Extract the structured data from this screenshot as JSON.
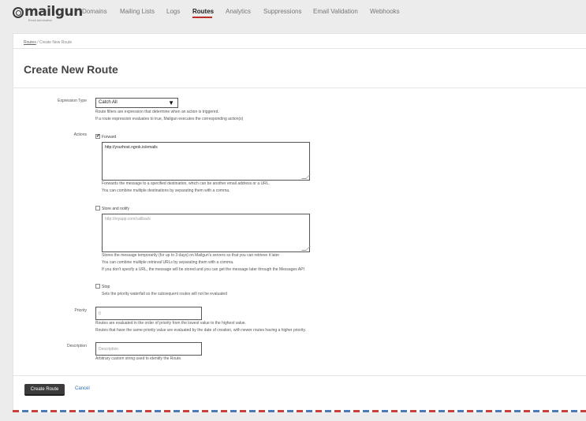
{
  "brand": {
    "logo_text": "mailgun",
    "logo_sub": "Email Automation"
  },
  "nav": {
    "items": [
      {
        "label": "Domains"
      },
      {
        "label": "Mailing Lists"
      },
      {
        "label": "Logs"
      },
      {
        "label": "Routes",
        "active": true
      },
      {
        "label": "Analytics"
      },
      {
        "label": "Suppressions"
      },
      {
        "label": "Email Validation"
      },
      {
        "label": "Webhooks"
      }
    ],
    "accent_color": "#c02d28"
  },
  "breadcrumb": {
    "parent": "Routes",
    "separator": " / ",
    "current": "Create New Route"
  },
  "page": {
    "title": "Create New Route"
  },
  "form": {
    "expression_type": {
      "label": "Expression Type",
      "value": "Catch All",
      "help": [
        "Route filters are expression that determine when an action is triggered.",
        "If a route expression evaluates to true, Mailgun executes the corresponding action(s)"
      ]
    },
    "actions": {
      "label": "Actions",
      "forward": {
        "checked": true,
        "label": "Forward",
        "value": "http://yourhost.ngrok.io/emails",
        "help": [
          "Forwards the message to a specified destination, which can be another email address or a URL.",
          "You can combine multiple destinations by separating them with a comma."
        ]
      },
      "store": {
        "checked": false,
        "label": "Store and notify",
        "placeholder": "http://myapp.com/callback",
        "help": [
          "Stores the message temporarily (for up to 3 days) on Mailgun's servers so that you can retrieve it later",
          "You can combine multiple retrieval URLs by separating them with a comma.",
          "If you don't specify a URL, the message will be stored and you can get the message later through the Messages API"
        ]
      },
      "stop": {
        "checked": false,
        "label": "Stop",
        "help": "Sets the priority waterfall so the subsequent routes will not be evaluated"
      }
    },
    "priority": {
      "label": "Priority",
      "placeholder": "0",
      "help": [
        "Routes are evaluated in the order of priority from the lowest value to the highest value.",
        "Routes that have the same priority value are evaluated by the date of creation, with newer routes having a higher priority."
      ]
    },
    "description": {
      "label": "Description",
      "placeholder": "Description",
      "help": "Arbitrary custom string used to identify the Route."
    }
  },
  "buttons": {
    "create": "Create Route",
    "cancel": "Cancel"
  }
}
